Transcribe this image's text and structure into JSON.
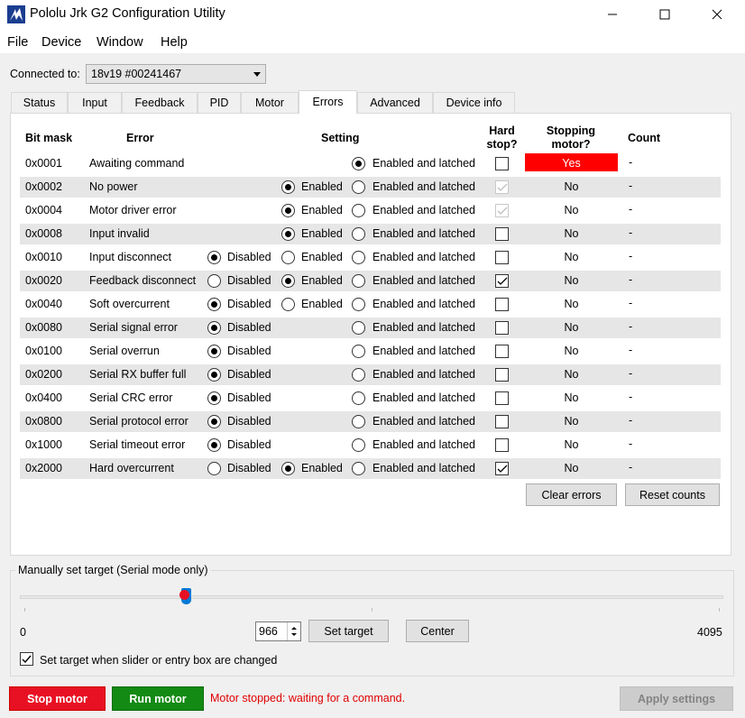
{
  "window": {
    "title": "Pololu Jrk G2 Configuration Utility"
  },
  "menu": [
    "File",
    "Device",
    "Window",
    "Help"
  ],
  "connection": {
    "label": "Connected to:",
    "device": "18v19 #00241467"
  },
  "tabs": [
    {
      "label": "Status",
      "active": false
    },
    {
      "label": "Input",
      "active": false
    },
    {
      "label": "Feedback",
      "active": false
    },
    {
      "label": "PID",
      "active": false
    },
    {
      "label": "Motor",
      "active": false
    },
    {
      "label": "Errors",
      "active": true
    },
    {
      "label": "Advanced",
      "active": false
    },
    {
      "label": "Device info",
      "active": false
    }
  ],
  "errors_table": {
    "headers": {
      "bit_mask": "Bit mask",
      "error": "Error",
      "setting": "Setting",
      "hard_stop": "Hard\nstop?",
      "stopping_motor": "Stopping\nmotor?",
      "count": "Count"
    },
    "option_labels": {
      "disabled": "Disabled",
      "enabled": "Enabled",
      "latched": "Enabled and latched"
    },
    "rows": [
      {
        "mask": "0x0001",
        "name": "Awaiting command",
        "options": [
          "latched"
        ],
        "selected": "latched",
        "hard_stop": false,
        "hard_stop_disabled": false,
        "stopping": "Yes",
        "count": "-"
      },
      {
        "mask": "0x0002",
        "name": "No power",
        "options": [
          "enabled",
          "latched"
        ],
        "selected": "enabled",
        "hard_stop": true,
        "hard_stop_disabled": true,
        "stopping": "No",
        "count": "-"
      },
      {
        "mask": "0x0004",
        "name": "Motor driver error",
        "options": [
          "enabled",
          "latched"
        ],
        "selected": "enabled",
        "hard_stop": true,
        "hard_stop_disabled": true,
        "stopping": "No",
        "count": "-"
      },
      {
        "mask": "0x0008",
        "name": "Input invalid",
        "options": [
          "enabled",
          "latched"
        ],
        "selected": "enabled",
        "hard_stop": false,
        "hard_stop_disabled": false,
        "stopping": "No",
        "count": "-"
      },
      {
        "mask": "0x0010",
        "name": "Input disconnect",
        "options": [
          "disabled",
          "enabled",
          "latched"
        ],
        "selected": "disabled",
        "hard_stop": false,
        "hard_stop_disabled": false,
        "stopping": "No",
        "count": "-"
      },
      {
        "mask": "0x0020",
        "name": "Feedback disconnect",
        "options": [
          "disabled",
          "enabled",
          "latched"
        ],
        "selected": "enabled",
        "hard_stop": true,
        "hard_stop_disabled": false,
        "stopping": "No",
        "count": "-"
      },
      {
        "mask": "0x0040",
        "name": "Soft overcurrent",
        "options": [
          "disabled",
          "enabled",
          "latched"
        ],
        "selected": "disabled",
        "hard_stop": false,
        "hard_stop_disabled": false,
        "stopping": "No",
        "count": "-"
      },
      {
        "mask": "0x0080",
        "name": "Serial signal error",
        "options": [
          "disabled",
          "latched"
        ],
        "selected": "disabled",
        "hard_stop": false,
        "hard_stop_disabled": false,
        "stopping": "No",
        "count": "-"
      },
      {
        "mask": "0x0100",
        "name": "Serial overrun",
        "options": [
          "disabled",
          "latched"
        ],
        "selected": "disabled",
        "hard_stop": false,
        "hard_stop_disabled": false,
        "stopping": "No",
        "count": "-"
      },
      {
        "mask": "0x0200",
        "name": "Serial RX buffer full",
        "options": [
          "disabled",
          "latched"
        ],
        "selected": "disabled",
        "hard_stop": false,
        "hard_stop_disabled": false,
        "stopping": "No",
        "count": "-"
      },
      {
        "mask": "0x0400",
        "name": "Serial CRC error",
        "options": [
          "disabled",
          "latched"
        ],
        "selected": "disabled",
        "hard_stop": false,
        "hard_stop_disabled": false,
        "stopping": "No",
        "count": "-"
      },
      {
        "mask": "0x0800",
        "name": "Serial protocol error",
        "options": [
          "disabled",
          "latched"
        ],
        "selected": "disabled",
        "hard_stop": false,
        "hard_stop_disabled": false,
        "stopping": "No",
        "count": "-"
      },
      {
        "mask": "0x1000",
        "name": "Serial timeout error",
        "options": [
          "disabled",
          "latched"
        ],
        "selected": "disabled",
        "hard_stop": false,
        "hard_stop_disabled": false,
        "stopping": "No",
        "count": "-"
      },
      {
        "mask": "0x2000",
        "name": "Hard overcurrent",
        "options": [
          "disabled",
          "enabled",
          "latched"
        ],
        "selected": "enabled",
        "hard_stop": true,
        "hard_stop_disabled": false,
        "stopping": "No",
        "count": "-"
      }
    ],
    "clear_errors_label": "Clear errors",
    "reset_counts_label": "Reset counts"
  },
  "manual_target": {
    "group_label": "Manually set target (Serial mode only)",
    "min_label": "0",
    "max_label": "4095",
    "value": "966",
    "slider_fraction": 0.236,
    "set_target_label": "Set target",
    "center_label": "Center",
    "auto_set_checked": true,
    "auto_set_label": "Set target when slider or entry box are changed"
  },
  "bottom": {
    "stop_motor_label": "Stop motor",
    "run_motor_label": "Run motor",
    "status_message": "Motor stopped: waiting for a command.",
    "apply_settings_label": "Apply settings"
  },
  "colors": {
    "stop_bg": "#e81123",
    "run_bg": "#138a13",
    "stopping_yes_bg": "#ff0000",
    "status_red": "#e00000",
    "slider_blue": "#0078d7"
  }
}
